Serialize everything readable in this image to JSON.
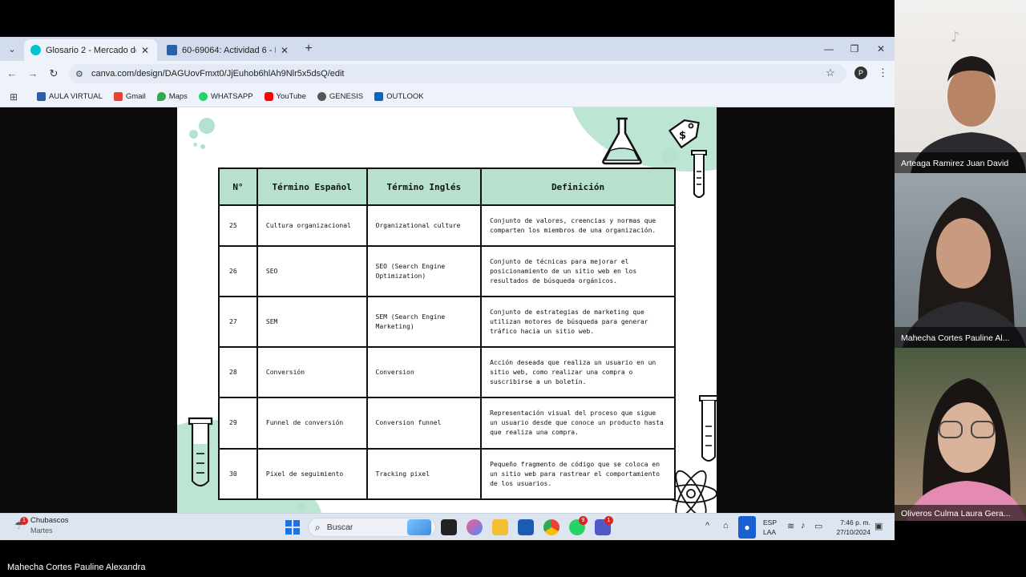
{
  "browser": {
    "tabs": [
      {
        "title": "Glosario 2 - Mercado de produ",
        "active": true
      },
      {
        "title": "60-69064: Actividad 6 - Evaluat",
        "active": false
      }
    ],
    "url": "canva.com/design/DAGUovFmxt0/JjEuhob6hlAh9Nlr5x5dsQ/edit",
    "profile_initial": "P",
    "bookmarks": [
      {
        "label": "AULA VIRTUAL",
        "color": "#2b5fa8"
      },
      {
        "label": "Gmail",
        "color": "#ea4335"
      },
      {
        "label": "Maps",
        "color": "#34a853"
      },
      {
        "label": "WHATSAPP",
        "color": "#25d366"
      },
      {
        "label": "YouTube",
        "color": "#ff0000"
      },
      {
        "label": "GENESIS",
        "color": "#555555"
      },
      {
        "label": "OUTLOOK",
        "color": "#0a64c8"
      }
    ]
  },
  "table": {
    "headers": [
      "N°",
      "Término Español",
      "Término Inglés",
      "Definición"
    ],
    "rows": [
      {
        "n": "25",
        "es": "Cultura organizacional",
        "en": "Organizational culture",
        "def": "Conjunto de valores, creencias y normas que comparten los miembros de una organización."
      },
      {
        "n": "26",
        "es": "SEO",
        "en": "SEO (Search Engine Optimization)",
        "def": "Conjunto de técnicas para mejorar el posicionamiento de un sitio web en los resultados de búsqueda orgánicos."
      },
      {
        "n": "27",
        "es": "SEM",
        "en": "SEM (Search Engine Marketing)",
        "def": "Conjunto de estrategias de marketing que utilizan motores de búsqueda para generar tráfico hacia un sitio web."
      },
      {
        "n": "28",
        "es": "Conversión",
        "en": "Conversion",
        "def": "Acción deseada que realiza un usuario en un sitio web, como realizar una compra o suscribirse a un boletín."
      },
      {
        "n": "29",
        "es": "Funnel de conversión",
        "en": "Conversion funnel",
        "def": "Representación visual del proceso que sigue un usuario desde que conoce un producto hasta que realiza una compra."
      },
      {
        "n": "30",
        "es": "Pixel de seguimiento",
        "en": "Tracking pixel",
        "def": "Pequeño fragmento de código que se coloca en un sitio web para rastrear el comportamiento de los usuarios."
      }
    ]
  },
  "taskbar": {
    "weather_title": "Chubascos",
    "weather_day": "Martes",
    "weather_badge": "1",
    "search_label": "Buscar",
    "lang_line1": "ESP",
    "lang_line2": "LAA",
    "time": "7:46 p. m.",
    "date": "27/10/2024",
    "chrome_badge": "",
    "whatsapp_badge": "9",
    "teams_badge": "1"
  },
  "participants": [
    {
      "name": "Arteaga Ramirez Juan David"
    },
    {
      "name": "Mahecha Cortes Pauline Al..."
    },
    {
      "name": "Oliveros Culma Laura Gera..."
    }
  ],
  "presenter_name": "Mahecha Cortes Pauline Alexandra",
  "colors": {
    "mint": "#b7e1cd",
    "accent": "#1a73e8"
  }
}
